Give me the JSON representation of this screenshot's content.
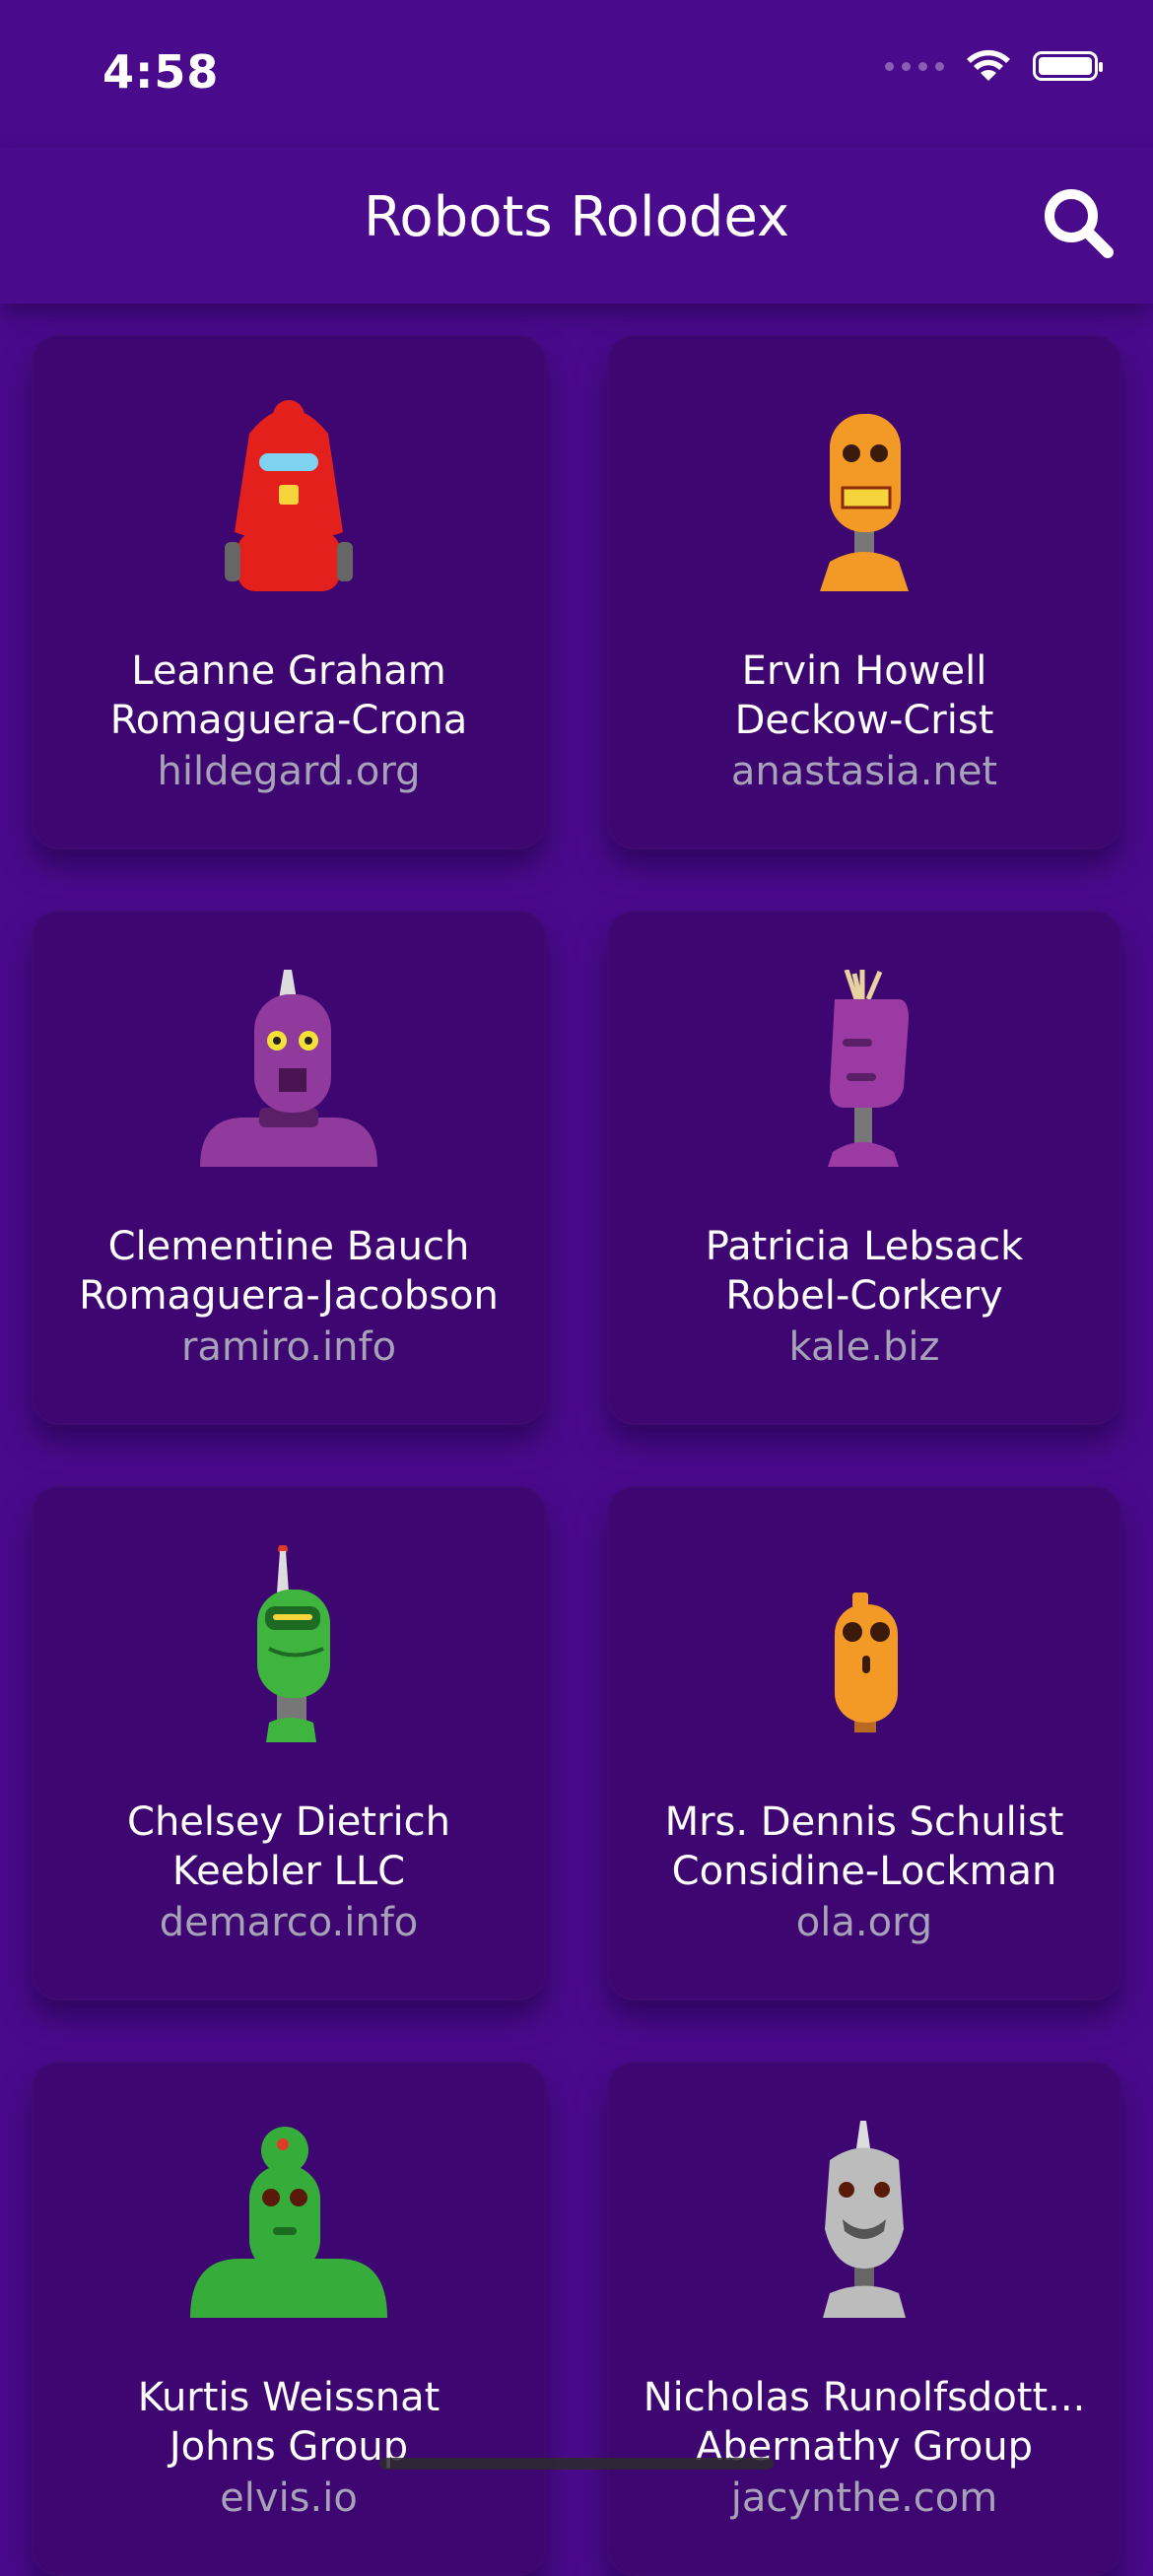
{
  "status": {
    "time": "4:58"
  },
  "header": {
    "title": "Robots Rolodex"
  },
  "robots": [
    {
      "name": "Leanne Graham",
      "company": "Romaguera-Crona",
      "website": "hildegard.org",
      "color": "#e3201c"
    },
    {
      "name": "Ervin Howell",
      "company": "Deckow-Crist",
      "website": "anastasia.net",
      "color": "#f29a25"
    },
    {
      "name": "Clementine Bauch",
      "company": "Romaguera-Jacobson",
      "website": "ramiro.info",
      "color": "#8f3a9c"
    },
    {
      "name": "Patricia Lebsack",
      "company": "Robel-Corkery",
      "website": "kale.biz",
      "color": "#9b3aa3"
    },
    {
      "name": "Chelsey Dietrich",
      "company": "Keebler LLC",
      "website": "demarco.info",
      "color": "#3fb53f"
    },
    {
      "name": "Mrs. Dennis Schulist",
      "company": "Considine-Lockman",
      "website": "ola.org",
      "color": "#f29a25"
    },
    {
      "name": "Kurtis Weissnat",
      "company": "Johns Group",
      "website": "elvis.io",
      "color": "#36ad3a"
    },
    {
      "name": "Nicholas Runolfsdott...",
      "company": "Abernathy Group",
      "website": "jacynthe.com",
      "color": "#bcbcbc"
    }
  ]
}
